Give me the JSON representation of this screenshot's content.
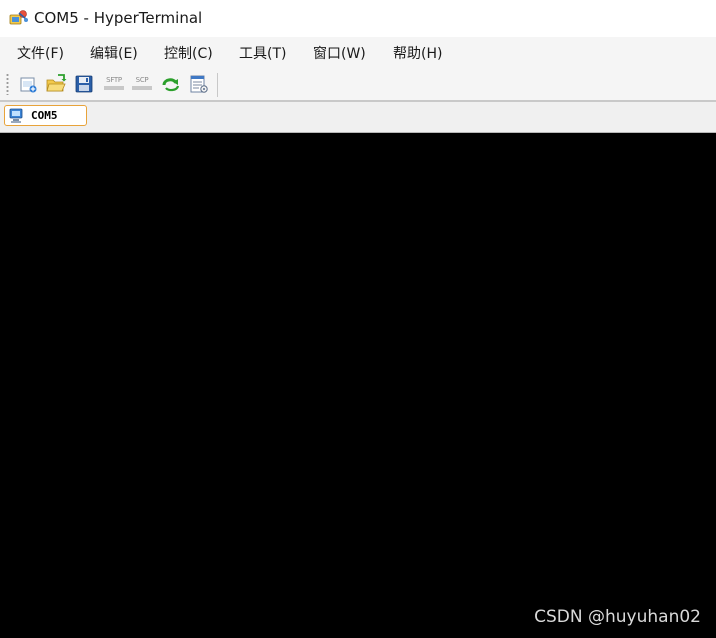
{
  "window": {
    "title": "COM5 - HyperTerminal",
    "icon": "hyperterminal-app-icon"
  },
  "menu": [
    {
      "label": "文件(F)"
    },
    {
      "label": "编辑(E)"
    },
    {
      "label": "控制(C)"
    },
    {
      "label": "工具(T)"
    },
    {
      "label": "窗口(W)"
    },
    {
      "label": "帮助(H)"
    }
  ],
  "toolbar": {
    "buttons": [
      {
        "icon": "new-session-icon"
      },
      {
        "icon": "open-folder-icon"
      },
      {
        "icon": "save-icon"
      },
      {
        "icon": "sftp-icon",
        "label": "SFTP"
      },
      {
        "icon": "scp-icon",
        "label": "SCP"
      },
      {
        "icon": "reconnect-icon"
      },
      {
        "icon": "properties-icon"
      }
    ]
  },
  "tabs": [
    {
      "label": "COM5",
      "icon": "computer-icon",
      "active": true
    }
  ],
  "terminal": {
    "content": "",
    "background": "#000000"
  },
  "watermark": "CSDN @huyuhan02",
  "colors": {
    "active_tab_border": "#e8a33a",
    "terminal_bg": "#000000",
    "chrome_bg": "#f5f5f5"
  }
}
